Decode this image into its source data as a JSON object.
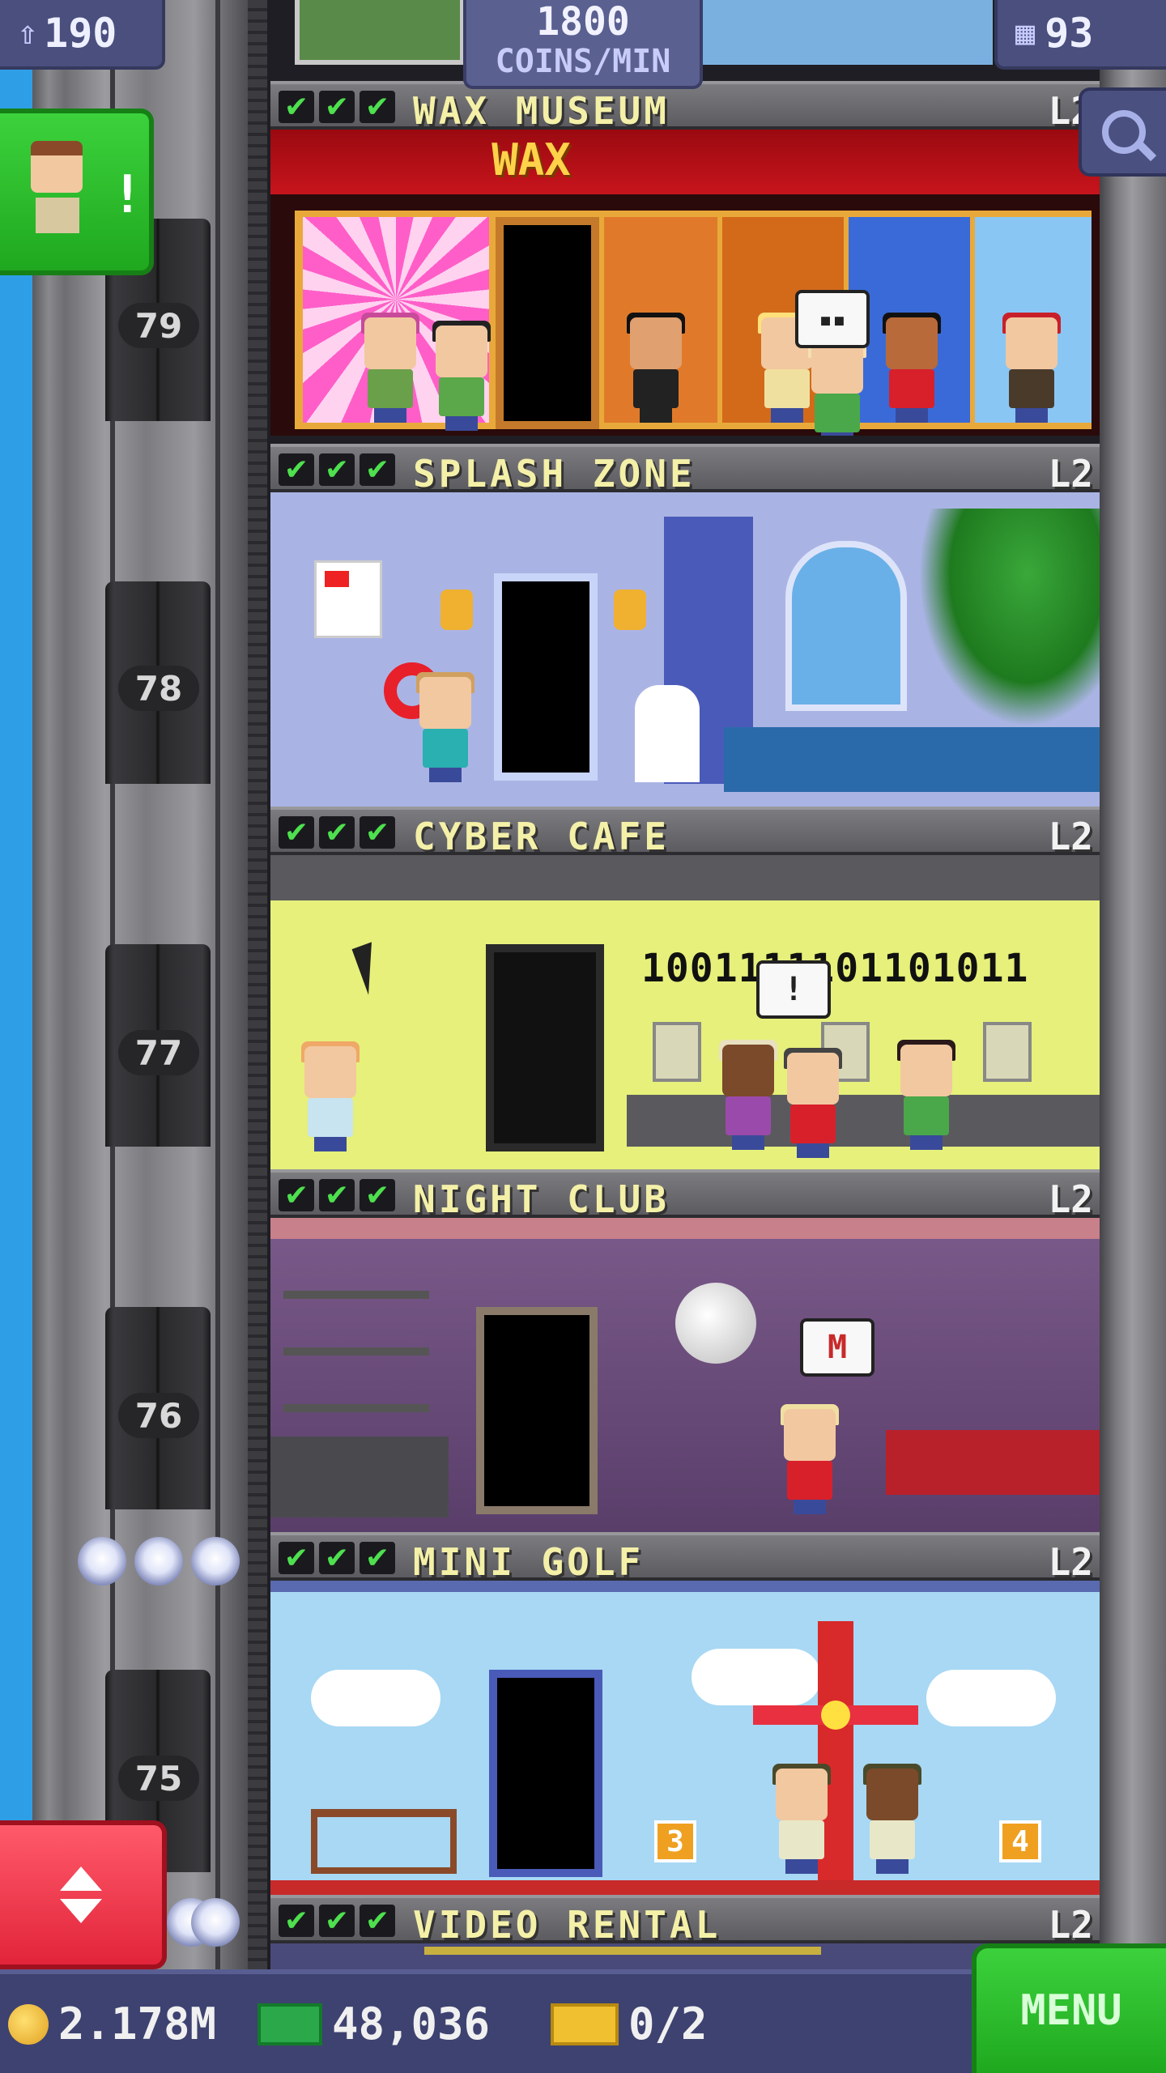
{
  "hud": {
    "population": "190",
    "coins_rate_value": "1800",
    "coins_rate_unit": "COINS/MIN",
    "floors_count": "93"
  },
  "floors": [
    {
      "name": "WAX MUSEUM",
      "level": "L2",
      "sign": "WAX",
      "elevator_floor": "79",
      "checks": [
        "✔",
        "✔",
        "✔"
      ],
      "bubble": ""
    },
    {
      "name": "SPLASH ZONE",
      "level": "L2",
      "elevator_floor": "78",
      "checks": [
        "✔",
        "✔",
        "✔"
      ]
    },
    {
      "name": "CYBER CAFE",
      "level": "L2",
      "elevator_floor": "77",
      "checks": [
        "✔",
        "✔",
        "✔"
      ],
      "binary_text": "1001111101101011",
      "bubble": "!"
    },
    {
      "name": "NIGHT CLUB",
      "level": "L2",
      "elevator_floor": "76",
      "checks": [
        "✔",
        "✔",
        "✔"
      ],
      "bubble": "M"
    },
    {
      "name": "MINI GOLF",
      "level": "L2",
      "elevator_floor": "75",
      "checks": [
        "✔",
        "✔",
        "✔"
      ],
      "hole_a": "3",
      "hole_b": "4"
    },
    {
      "name": "VIDEO RENTAL",
      "level": "L2",
      "checks": [
        "✔",
        "✔",
        "✔"
      ]
    }
  ],
  "bottom": {
    "coins": "2.178M",
    "bux": "48,036",
    "tickets": "0/2",
    "menu_label": "MENU"
  },
  "colors": {
    "accent_green": "#1fa81f",
    "elevator_red": "#e2243a",
    "hud_blue": "#3d4270",
    "name_yellow": "#f4f0a8"
  }
}
